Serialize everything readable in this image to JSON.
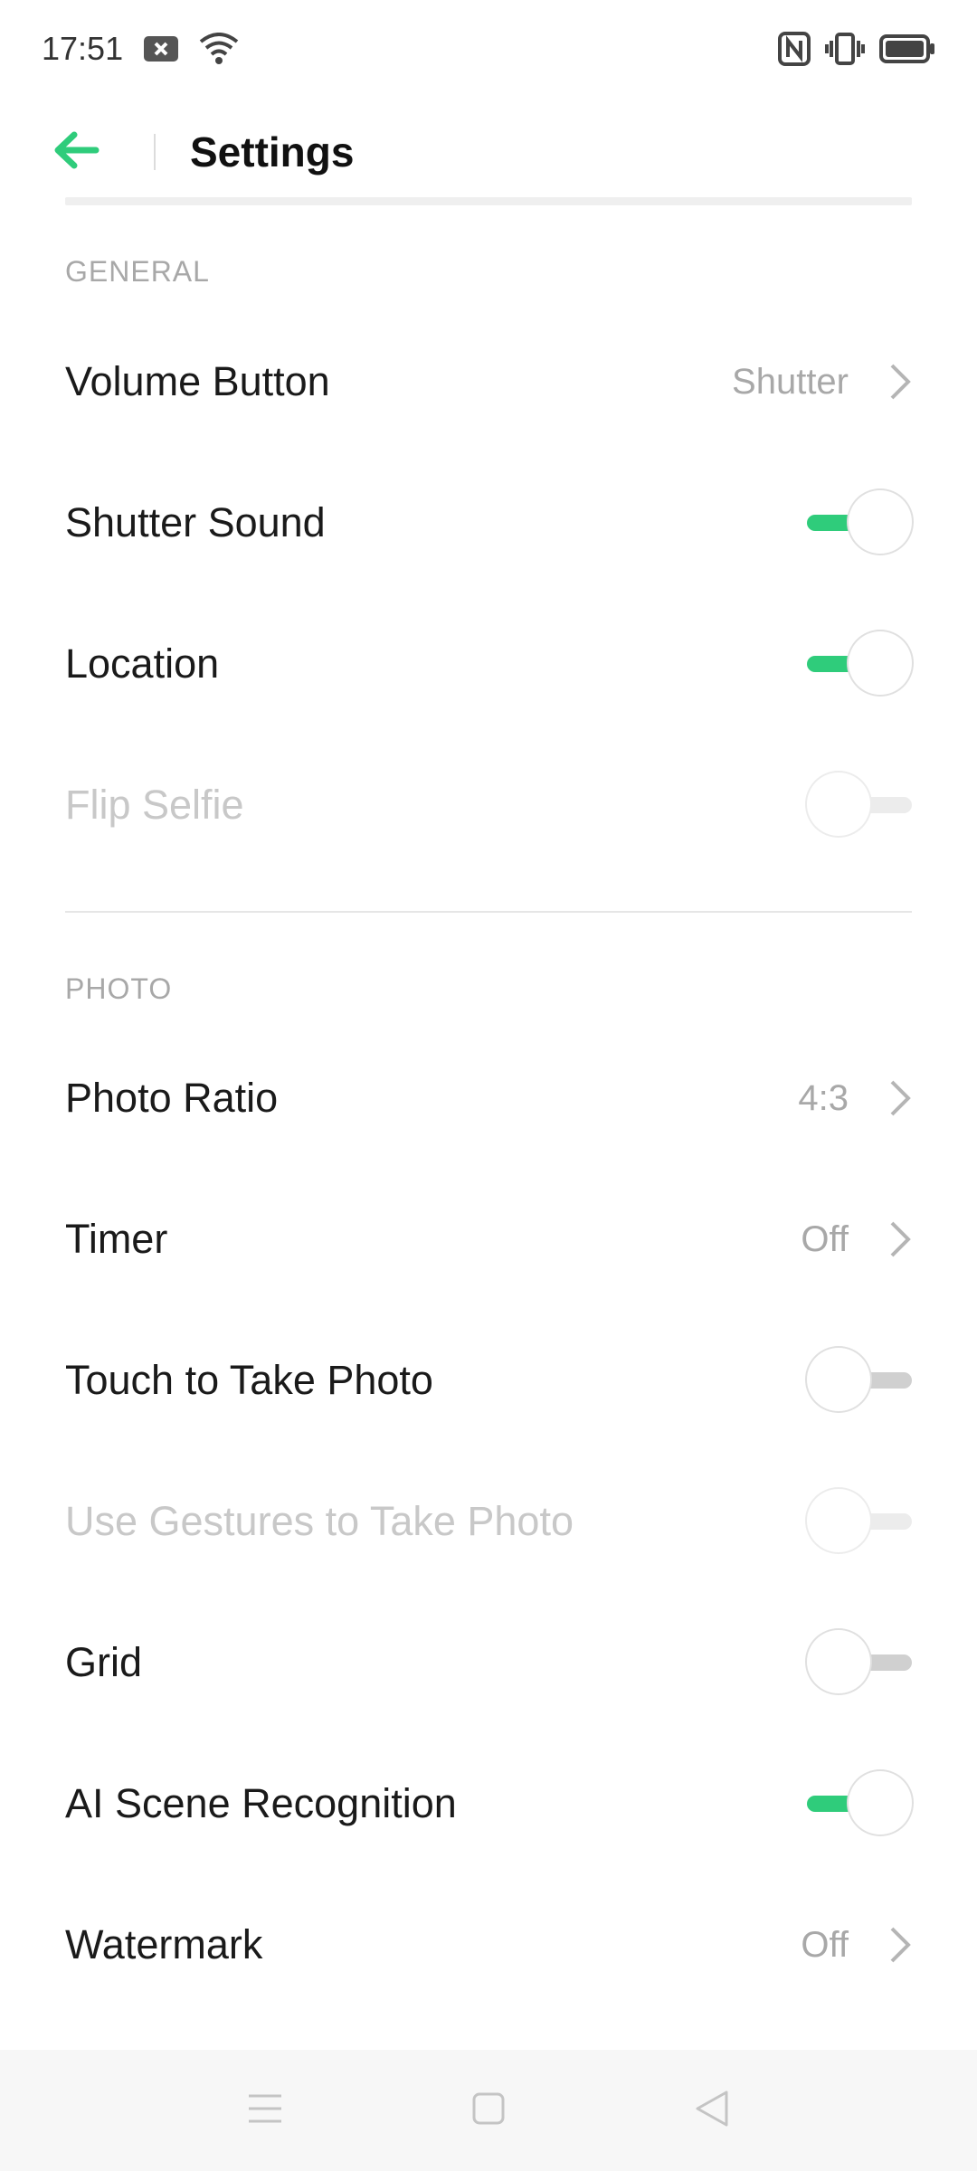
{
  "status_bar": {
    "time": "17:51",
    "icons": [
      "notification-x-icon",
      "wifi-icon",
      "nfc-icon",
      "vibrate-icon",
      "battery-icon"
    ]
  },
  "app_bar": {
    "back_icon": "arrow-left-icon",
    "title": "Settings",
    "accent_color": "#2fcc7b"
  },
  "sections": [
    {
      "header": "GENERAL",
      "items": [
        {
          "label": "Volume Button",
          "type": "value",
          "value": "Shutter"
        },
        {
          "label": "Shutter Sound",
          "type": "toggle",
          "on": true,
          "enabled": true
        },
        {
          "label": "Location",
          "type": "toggle",
          "on": true,
          "enabled": true
        },
        {
          "label": "Flip Selfie",
          "type": "toggle",
          "on": false,
          "enabled": false
        }
      ]
    },
    {
      "header": "PHOTO",
      "items": [
        {
          "label": "Photo Ratio",
          "type": "value",
          "value": "4:3"
        },
        {
          "label": "Timer",
          "type": "value",
          "value": "Off"
        },
        {
          "label": "Touch to Take Photo",
          "type": "toggle",
          "on": false,
          "enabled": true
        },
        {
          "label": "Use Gestures to Take Photo",
          "type": "toggle",
          "on": false,
          "enabled": false
        },
        {
          "label": "Grid",
          "type": "toggle",
          "on": false,
          "enabled": true
        },
        {
          "label": "AI Scene Recognition",
          "type": "toggle",
          "on": true,
          "enabled": true
        },
        {
          "label": "Watermark",
          "type": "value",
          "value": "Off"
        }
      ]
    }
  ],
  "nav_bar": {
    "icons": [
      "menu-icon",
      "home-square-icon",
      "back-triangle-icon"
    ]
  }
}
